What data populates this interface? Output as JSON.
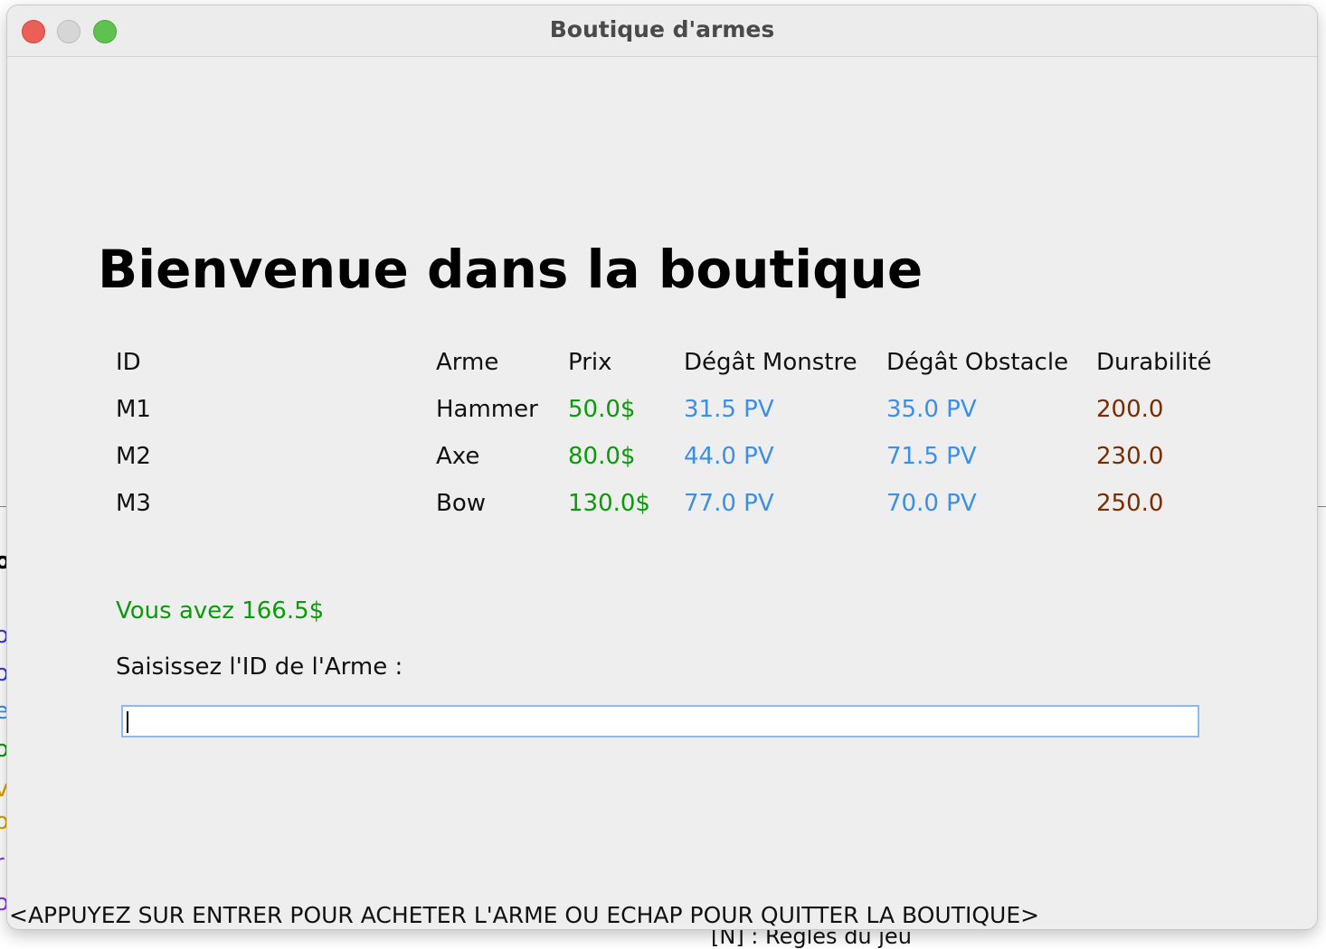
{
  "window": {
    "title": "Boutique d'armes"
  },
  "shop": {
    "heading": "Bienvenue dans la boutique",
    "columns": [
      "ID",
      "Arme",
      "Prix",
      "Dégât Monstre",
      "Dégât Obstacle",
      "Durabilité"
    ],
    "rows": [
      {
        "id": "M1",
        "weapon": "Hammer",
        "price": "50.0$",
        "monster_damage": "31.5 PV",
        "obstacle_damage": "35.0 PV",
        "durability": "200.0"
      },
      {
        "id": "M2",
        "weapon": "Axe",
        "price": "80.0$",
        "monster_damage": "44.0 PV",
        "obstacle_damage": "71.5 PV",
        "durability": "230.0"
      },
      {
        "id": "M3",
        "weapon": "Bow",
        "price": "130.0$",
        "monster_damage": "77.0 PV",
        "obstacle_damage": "70.0 PV",
        "durability": "250.0"
      }
    ],
    "balance": "Vous avez 166.5$",
    "input_label": "Saisissez l'ID de l'Arme :",
    "input_value": "",
    "hint": "<APPUYEZ SUR ENTRER POUR ACHETER L'ARME OU ECHAP POUR QUITTER LA BOUTIQUE>"
  },
  "background": {
    "bottom_text": "[N] : Règles du jeu"
  },
  "colors": {
    "price": "#0a9a0a",
    "damage": "#3c8fe6",
    "durability": "#7a2d00",
    "balance": "#0a9a0a"
  }
}
